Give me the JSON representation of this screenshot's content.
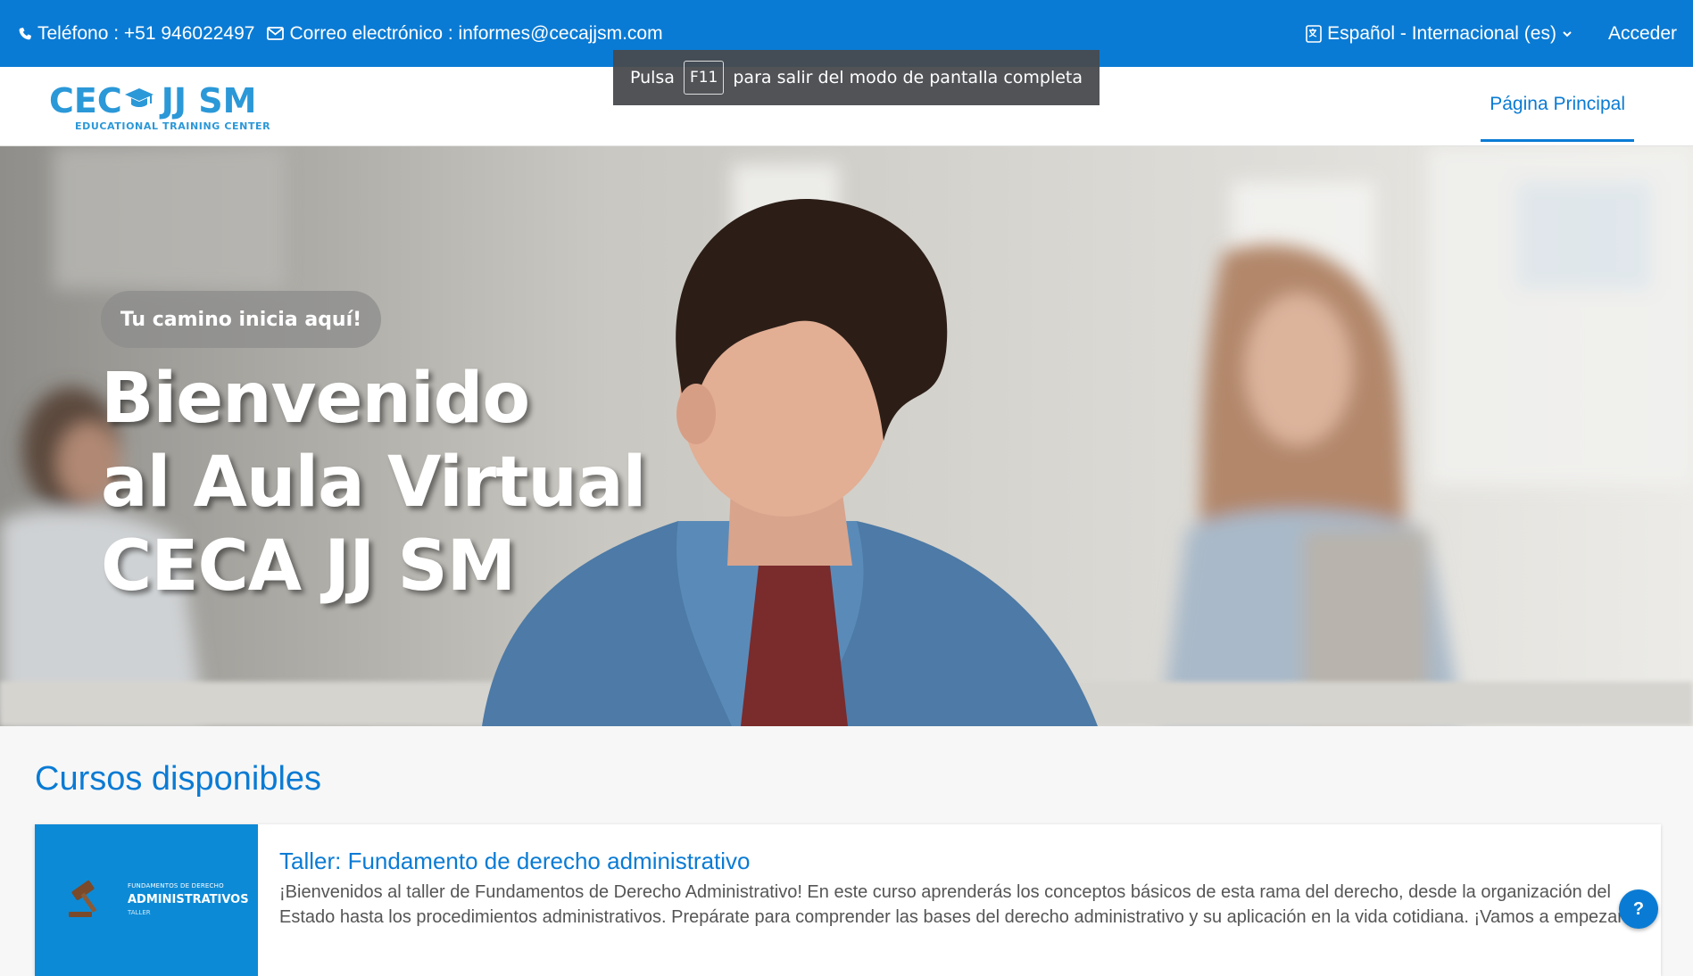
{
  "topbar": {
    "phone": "Teléfono : +51 946022497",
    "email": "Correo electrónico : informes@cecajjsm.com",
    "language": "Español - Internacional (es)",
    "login": "Acceder"
  },
  "fullscreen_notice": {
    "before": "Pulsa",
    "key": "F11",
    "after": "para salir del modo de pantalla completa"
  },
  "logo": {
    "left": "CEC",
    "right": "JJ SM",
    "subtitle": "EDUCATIONAL TRAINING CENTER"
  },
  "nav": {
    "home": "Página Principal"
  },
  "hero": {
    "badge": "Tu camino inicia aquí!",
    "title_lines": [
      "Bienvenido",
      "al Aula Virtual",
      "CECA JJ SM"
    ]
  },
  "courses": {
    "heading": "Cursos disponibles",
    "items": [
      {
        "thumb_small": "FUNDAMENTOS DE DERECHO",
        "thumb_big": "ADMINISTRATIVOS",
        "thumb_tag": "TALLER",
        "name": "Taller: Fundamento de derecho administrativo",
        "description": "¡Bienvenidos al taller de Fundamentos de Derecho Administrativo! En este curso aprenderás los conceptos básicos de esta rama del derecho, desde la organización del Estado hasta los procedimientos administrativos. Prepárate para comprender las bases del derecho administrativo y su aplicación en la vida cotidiana. ¡Vamos a empezar!..."
      }
    ]
  },
  "help": {
    "label": "?"
  },
  "colors": {
    "primary": "#0a7bd4",
    "logo": "#2b98d8"
  }
}
